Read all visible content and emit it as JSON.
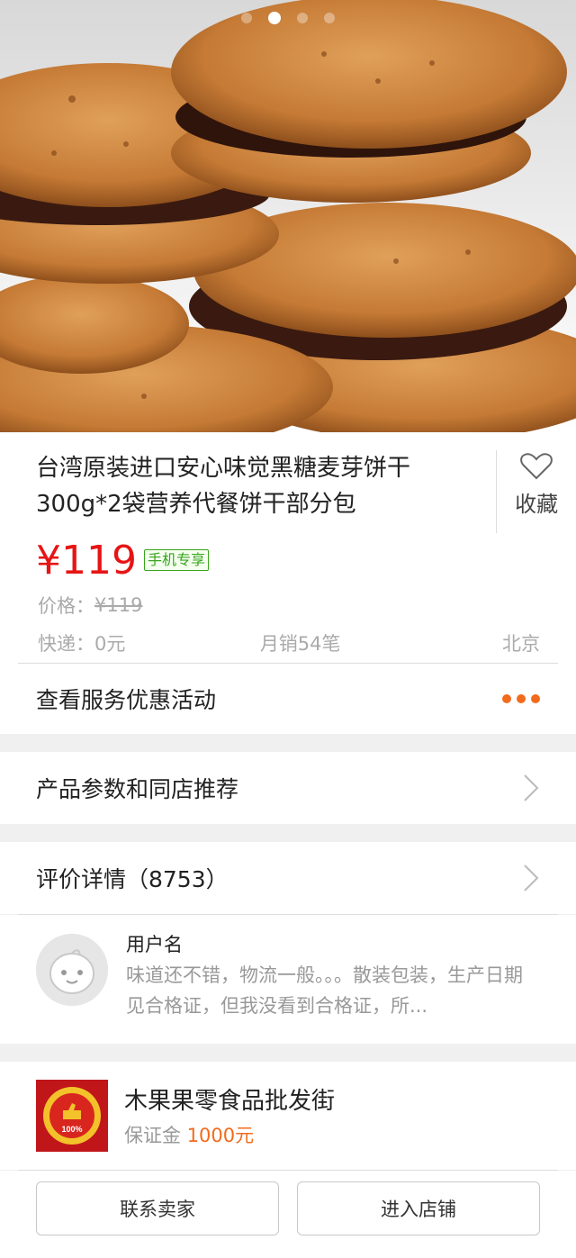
{
  "hero": {
    "image": "product-photo-sandwich-cookies",
    "slide_count": 4,
    "active_slide": 2
  },
  "product": {
    "title": "台湾原装进口安心味觉黑糖麦芽饼干300g*2袋营养代餐饼干部分包",
    "favorite_label": "收藏",
    "price": "¥119",
    "badge": "手机专享",
    "original_price_label": "价格：",
    "original_price": "¥119",
    "shipping": "快递：0元",
    "monthly_sales": "月销54笔",
    "location": "北京",
    "promo_label": "查看服务优惠活动"
  },
  "sections": {
    "params_label": "产品参数和同店推荐",
    "reviews_label": "评价详情（8753）"
  },
  "review": {
    "username": "用户名",
    "text": "味道还不错，物流一般。。。散装包装，生产日期见合格证，但我没看到合格证，所..."
  },
  "shop": {
    "name": "木果果零食品批发街",
    "deposit_label": "保证金",
    "deposit_amount": "1000元",
    "logo_text": "100%"
  },
  "buttons": {
    "contact": "联系卖家",
    "enter_store": "进入店铺"
  },
  "colors": {
    "price": "#e61515",
    "accent": "#f26b1d",
    "badge": "#37a51d"
  }
}
